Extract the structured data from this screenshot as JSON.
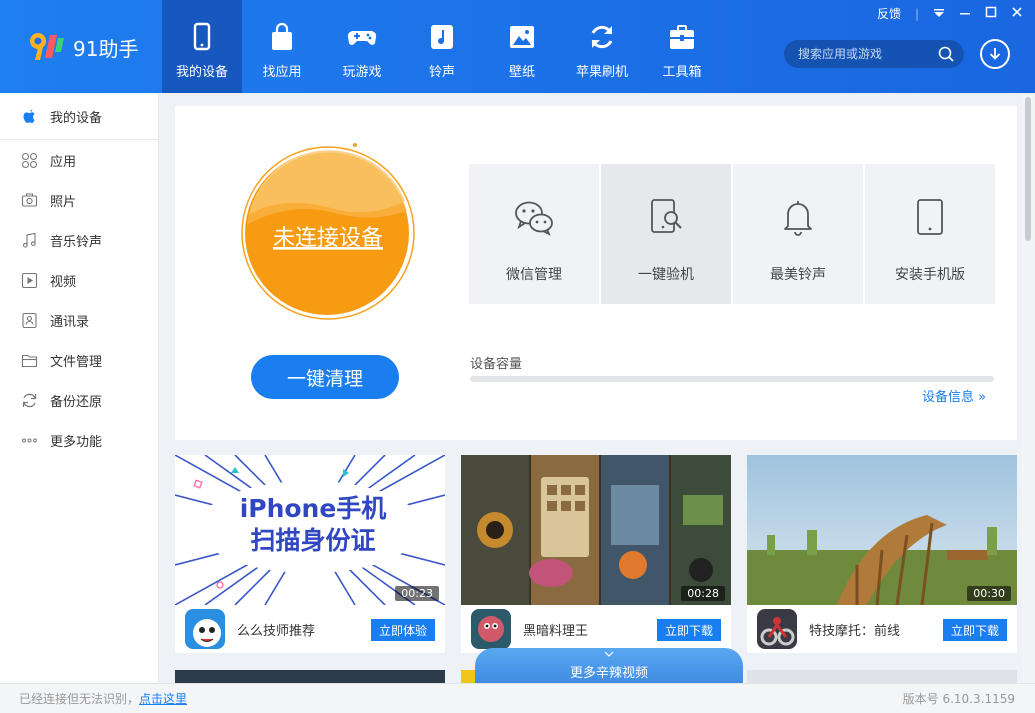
{
  "app": {
    "name": "91助手",
    "feedback": "反馈",
    "version_label": "版本号 6.10.3.1159",
    "status_text": "已经连接但无法识别，",
    "status_link": "点击这里"
  },
  "nav": [
    {
      "label": "我的设备",
      "icon": "phone-icon",
      "active": true
    },
    {
      "label": "找应用",
      "icon": "bag-icon"
    },
    {
      "label": "玩游戏",
      "icon": "gamepad-icon"
    },
    {
      "label": "铃声",
      "icon": "music-note-icon"
    },
    {
      "label": "壁纸",
      "icon": "picture-icon"
    },
    {
      "label": "苹果刷机",
      "icon": "refresh-icon"
    },
    {
      "label": "工具箱",
      "icon": "toolbox-icon"
    }
  ],
  "search": {
    "placeholder": "搜索应用或游戏"
  },
  "sidebar": [
    {
      "label": "我的设备",
      "icon": "apple-icon"
    },
    {
      "label": "应用",
      "icon": "apps-grid-icon"
    },
    {
      "label": "照片",
      "icon": "camera-icon"
    },
    {
      "label": "音乐铃声",
      "icon": "music-icon"
    },
    {
      "label": "视频",
      "icon": "video-icon"
    },
    {
      "label": "通讯录",
      "icon": "contacts-icon"
    },
    {
      "label": "文件管理",
      "icon": "folder-icon"
    },
    {
      "label": "备份还原",
      "icon": "sync-icon"
    },
    {
      "label": "更多功能",
      "icon": "more-dots-icon"
    }
  ],
  "device": {
    "status": "未连接设备",
    "clean_button": "一键清理",
    "capacity_label": "设备容量",
    "capacity_used_fraction": 0,
    "info_link": "设备信息 »"
  },
  "tools": [
    {
      "label": "微信管理",
      "icon": "wechat-icon"
    },
    {
      "label": "一键验机",
      "icon": "device-check-icon"
    },
    {
      "label": "最美铃声",
      "icon": "bell-icon"
    },
    {
      "label": "安装手机版",
      "icon": "tablet-icon"
    }
  ],
  "videos": [
    {
      "thumb_title_line1": "iPhone手机",
      "thumb_title_line2": "扫描身份证",
      "duration": "00:23",
      "app_name": "么么技师推荐",
      "button": "立即体验"
    },
    {
      "duration": "00:28",
      "app_name": "黑暗料理王",
      "button": "立即下载"
    },
    {
      "duration": "00:30",
      "app_name": "特技摩托：前线",
      "button": "立即下载"
    }
  ],
  "more_videos": "更多辛辣视频",
  "colors": {
    "brand": "#1a7ef0",
    "titlebar": "#1c6fe6",
    "orange": "#f7a11f"
  }
}
